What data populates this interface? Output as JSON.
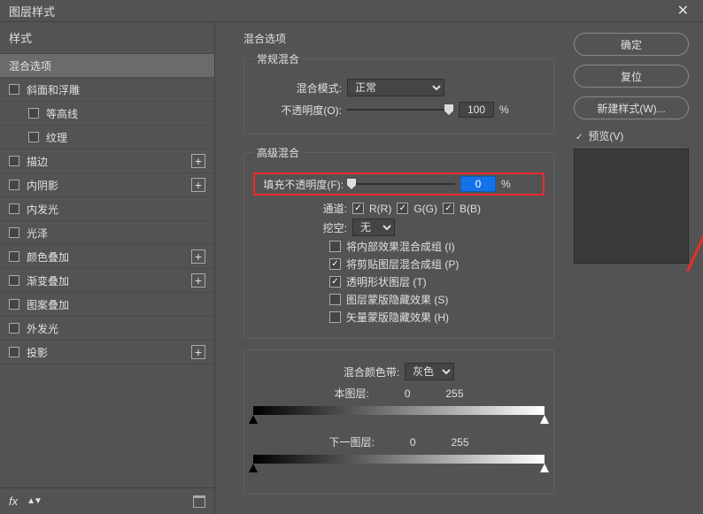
{
  "dialog": {
    "title": "图层样式"
  },
  "sidebar": {
    "header": "样式",
    "items": [
      {
        "label": "混合选项",
        "active": true
      },
      {
        "label": "斜面和浮雕",
        "checkbox": true
      },
      {
        "label": "等高线",
        "checkbox": true,
        "sub": true
      },
      {
        "label": "纹理",
        "checkbox": true,
        "sub": true
      },
      {
        "label": "描边",
        "checkbox": true,
        "plus": true
      },
      {
        "label": "内阴影",
        "checkbox": true,
        "plus": true
      },
      {
        "label": "内发光",
        "checkbox": true
      },
      {
        "label": "光泽",
        "checkbox": true
      },
      {
        "label": "颜色叠加",
        "checkbox": true,
        "plus": true
      },
      {
        "label": "渐变叠加",
        "checkbox": true,
        "plus": true
      },
      {
        "label": "图案叠加",
        "checkbox": true
      },
      {
        "label": "外发光",
        "checkbox": true
      },
      {
        "label": "投影",
        "checkbox": true,
        "plus": true
      }
    ],
    "footer_fx": "fx"
  },
  "panel": {
    "title": "混合选项",
    "general": {
      "legend": "常规混合",
      "mode_label": "混合模式:",
      "mode_value": "正常",
      "opacity_label": "不透明度(O):",
      "opacity_value": "100",
      "pct": "%"
    },
    "advanced": {
      "legend": "高级混合",
      "fill_label": "填充不透明度(F):",
      "fill_value": "0",
      "pct": "%",
      "channels_label": "通道:",
      "ch_r": "R(R)",
      "ch_g": "G(G)",
      "ch_b": "B(B)",
      "knockout_label": "挖空:",
      "knockout_value": "无",
      "opts": [
        {
          "label": "将内部效果混合成组 (I)",
          "checked": false
        },
        {
          "label": "将剪贴图层混合成组 (P)",
          "checked": true
        },
        {
          "label": "透明形状图层 (T)",
          "checked": true
        },
        {
          "label": "图层蒙版隐藏效果 (S)",
          "checked": false
        },
        {
          "label": "矢量蒙版隐藏效果 (H)",
          "checked": false
        }
      ]
    },
    "blendif": {
      "label": "混合颜色带:",
      "value": "灰色",
      "this_label": "本图层:",
      "this_low": "0",
      "this_high": "255",
      "under_label": "下一图层:",
      "under_low": "0",
      "under_high": "255"
    }
  },
  "buttons": {
    "ok": "确定",
    "cancel": "复位",
    "newstyle": "新建样式(W)...",
    "preview": "预览(V)"
  }
}
